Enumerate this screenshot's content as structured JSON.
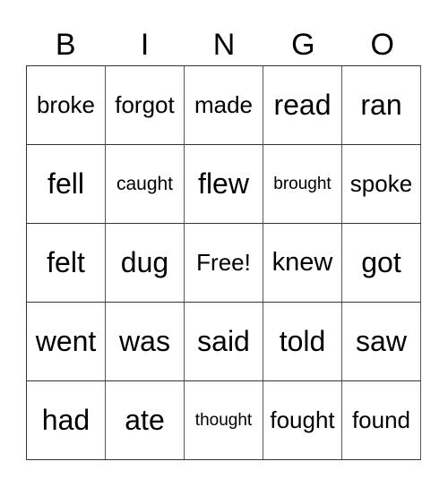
{
  "title_letters": [
    "B",
    "I",
    "N",
    "G",
    "O"
  ],
  "board": [
    [
      "broke",
      "forgot",
      "made",
      "read",
      "ran"
    ],
    [
      "fell",
      "caught",
      "flew",
      "brought",
      "spoke"
    ],
    [
      "felt",
      "dug",
      "Free!",
      "knew",
      "got"
    ],
    [
      "went",
      "was",
      "said",
      "told",
      "saw"
    ],
    [
      "had",
      "ate",
      "thought",
      "fought",
      "found"
    ]
  ]
}
